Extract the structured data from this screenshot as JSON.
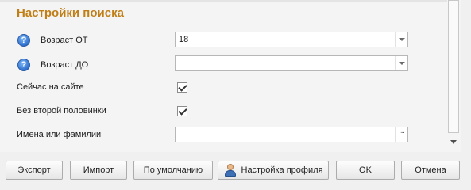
{
  "section": {
    "title": "Настройки поиска"
  },
  "fields": {
    "age_from": {
      "label": "Возраст ОТ",
      "value": "18"
    },
    "age_to": {
      "label": "Возраст ДО",
      "value": ""
    },
    "online_now": {
      "label": "Сейчас на сайте",
      "checked": true
    },
    "single": {
      "label": "Без второй половинки",
      "checked": true
    },
    "names": {
      "label": "Имена или фамилии",
      "value": ""
    }
  },
  "icons": {
    "help": "help-icon",
    "profile": "user-profile-icon",
    "ellipsis": "ellipsis-icon",
    "help_glyph": "?",
    "dots_glyph": "···"
  },
  "buttons": {
    "export": "Экспорт",
    "import": "Импорт",
    "default": "По умолчанию",
    "profile_settings": "Настройка профиля",
    "ok": "OK",
    "cancel": "Отмена"
  },
  "colors": {
    "title": "#c07f16",
    "help_icon": "#2e6fcf"
  }
}
